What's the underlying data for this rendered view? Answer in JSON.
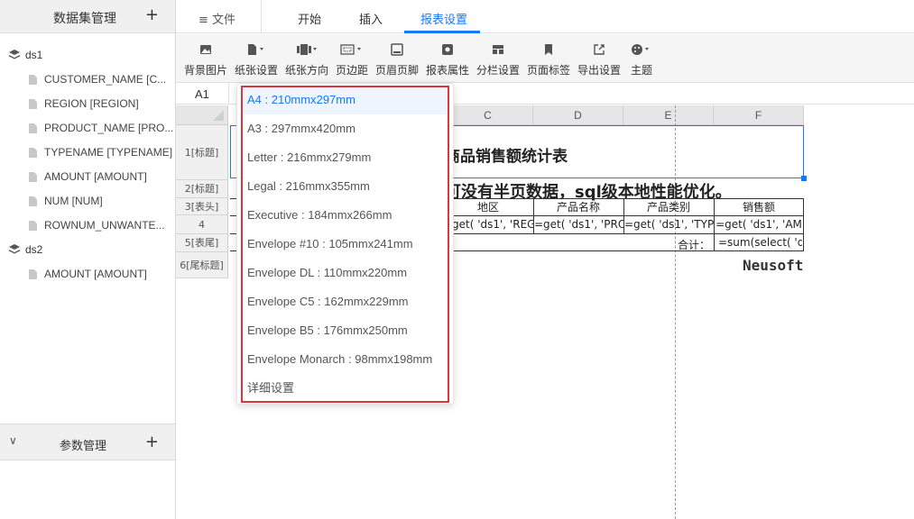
{
  "left_panel": {
    "title": "数据集管理",
    "add_label": "+",
    "datasets": [
      {
        "name": "ds1",
        "fields": [
          "CUSTOMER_NAME [C...",
          "REGION [REGION]",
          "PRODUCT_NAME [PRO...",
          "TYPENAME [TYPENAME]",
          "AMOUNT [AMOUNT]",
          "NUM [NUM]",
          "ROWNUM_UNWANTE..."
        ]
      },
      {
        "name": "ds2",
        "fields": [
          "AMOUNT [AMOUNT]"
        ]
      }
    ],
    "param_title": "参数管理",
    "param_add_label": "+",
    "param_chevron": "∨"
  },
  "tabs": {
    "file": "≡ 文件",
    "items": [
      "开始",
      "插入",
      "报表设置"
    ],
    "active": "报表设置",
    "accent": "#1677ff"
  },
  "toolbar": {
    "items": [
      {
        "label": "背景图片",
        "icon": "image-icon"
      },
      {
        "label": "纸张设置",
        "icon": "paper-icon"
      },
      {
        "label": "纸张方向",
        "icon": "orientation-icon"
      },
      {
        "label": "页边距",
        "icon": "margin-icon"
      },
      {
        "label": "页眉页脚",
        "icon": "header-footer-icon"
      },
      {
        "label": "报表属性",
        "icon": "gear-icon"
      },
      {
        "label": "分栏设置",
        "icon": "columns-icon"
      },
      {
        "label": "页面标签",
        "icon": "bookmark-icon"
      },
      {
        "label": "导出设置",
        "icon": "export-icon"
      },
      {
        "label": "主题",
        "icon": "palette-icon"
      }
    ]
  },
  "formula_bar": {
    "cell_ref": "A1"
  },
  "grid": {
    "columns": [
      "C",
      "D",
      "E",
      "F"
    ],
    "rows": [
      "1[标题]",
      "2[标题]",
      "3[表头]",
      "4",
      "5[表尾]",
      "6[尾标题]"
    ],
    "title": "商品销售额统计表",
    "subtitle": "可没有半页数据，sql级本地性能优化。",
    "headers": [
      "地区",
      "产品名称",
      "产品类别",
      "销售额"
    ],
    "data_row": [
      "get( 'ds1', 'REG",
      "=get( 'ds1', 'PRO",
      "=get( 'ds1', 'TYP",
      "=get( 'ds1', 'AM"
    ],
    "sum_label": "合计：",
    "sum_formula": "=sum(select( 'ds",
    "footer_text": "Neusoft"
  },
  "paper_dropdown": {
    "items": [
      "A4 : 210mmx297mm",
      "A3 : 297mmx420mm",
      "Letter : 216mmx279mm",
      "Legal : 216mmx355mm",
      "Executive : 184mmx266mm",
      "Envelope #10 : 105mmx241mm",
      "Envelope DL : 110mmx220mm",
      "Envelope C5 : 162mmx229mm",
      "Envelope B5 : 176mmx250mm",
      "Envelope Monarch : 98mmx198mm",
      "详细设置"
    ],
    "selected": "A4 : 210mmx297mm",
    "highlight_color": "#d9363e"
  }
}
